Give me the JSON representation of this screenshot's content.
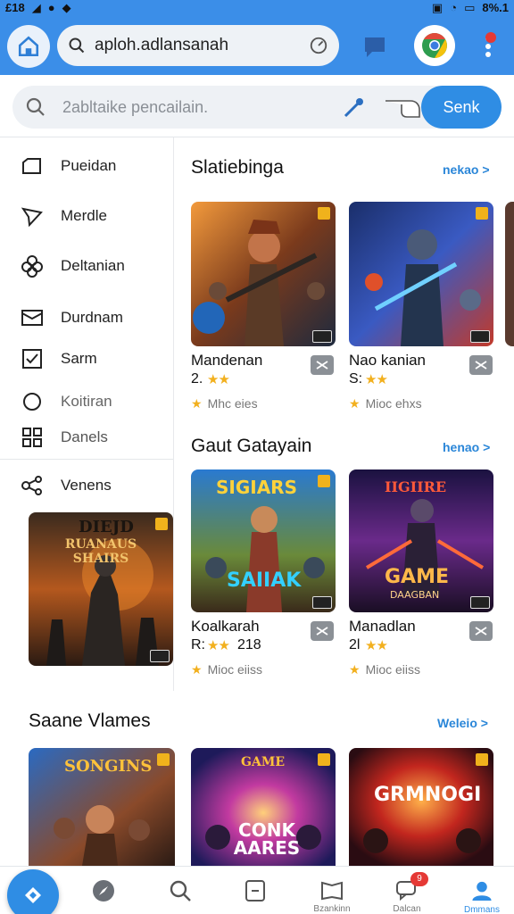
{
  "status_bar": {
    "left_text": "£18",
    "battery_text": "8%.1"
  },
  "browser": {
    "url": "aploh.adlansanah",
    "home_icon": "home-icon",
    "accent": "#3b8ee8"
  },
  "search": {
    "placeholder": "2abltaike pencailain.",
    "send_label": "Senk"
  },
  "sidebar": {
    "items": [
      {
        "label": "Pueidan",
        "icon": "folder-icon"
      },
      {
        "label": "Merdle",
        "icon": "send-icon"
      },
      {
        "label": "Deltanian",
        "icon": "flower-icon"
      },
      {
        "label": "Durdnam",
        "icon": "mail-icon"
      },
      {
        "label": "Sarm",
        "icon": "checkbox-icon"
      },
      {
        "label": "Koitiran",
        "icon": "circle-icon"
      },
      {
        "label": "Danels",
        "icon": "grid-icon"
      },
      {
        "label": "Venens",
        "icon": "share-icon"
      }
    ],
    "promo_card_title": "DIEJD",
    "promo_card_subtitle": "RUANAUS SHAIRS"
  },
  "sections": [
    {
      "title": "Slatiebinga",
      "more": "nekao >",
      "cards": [
        {
          "name": "Mandenan",
          "rating_prefix": "2.",
          "stars": "★★",
          "meta": "Mhc eies"
        },
        {
          "name": "Nao kanian",
          "rating_prefix": "S:",
          "stars": "★★",
          "meta": "Mioc ehxs"
        }
      ]
    },
    {
      "title": "Gaut Gatayain",
      "more": "henao >",
      "cards": [
        {
          "name": "Koalkarah",
          "rating_prefix": "R:",
          "stars": "★★",
          "rating_suffix": "218",
          "meta": "Mioc eiiss",
          "thumb_title": "SIGIARS",
          "thumb_sub": "SAIIAK"
        },
        {
          "name": "Manadlan",
          "rating_prefix": "2l",
          "stars": "★★",
          "meta": "Mioc eiiss",
          "thumb_title": "IIGIIRE",
          "thumb_sub": "GAME",
          "thumb_sub2": "DAAGBAN"
        }
      ]
    },
    {
      "title": "Saane Vlames",
      "more": "Weleio >",
      "cards": [
        {
          "thumb_title": "SONGINS"
        },
        {
          "thumb_title": "GAME",
          "thumb_sub": "CONK AARES"
        },
        {
          "thumb_title": "GRMNOGI"
        }
      ]
    }
  ],
  "bottom_nav": {
    "items": [
      {
        "label": "",
        "icon": "explore-icon"
      },
      {
        "label": "",
        "icon": "compass-icon"
      },
      {
        "label": "",
        "icon": "search-icon"
      },
      {
        "label": "",
        "icon": "document-icon"
      },
      {
        "label": "Bzankinn",
        "icon": "library-icon"
      },
      {
        "label": "Dalcan",
        "icon": "chat-icon",
        "badge": "9"
      },
      {
        "label": "Dmmans",
        "icon": "profile-icon"
      }
    ]
  }
}
